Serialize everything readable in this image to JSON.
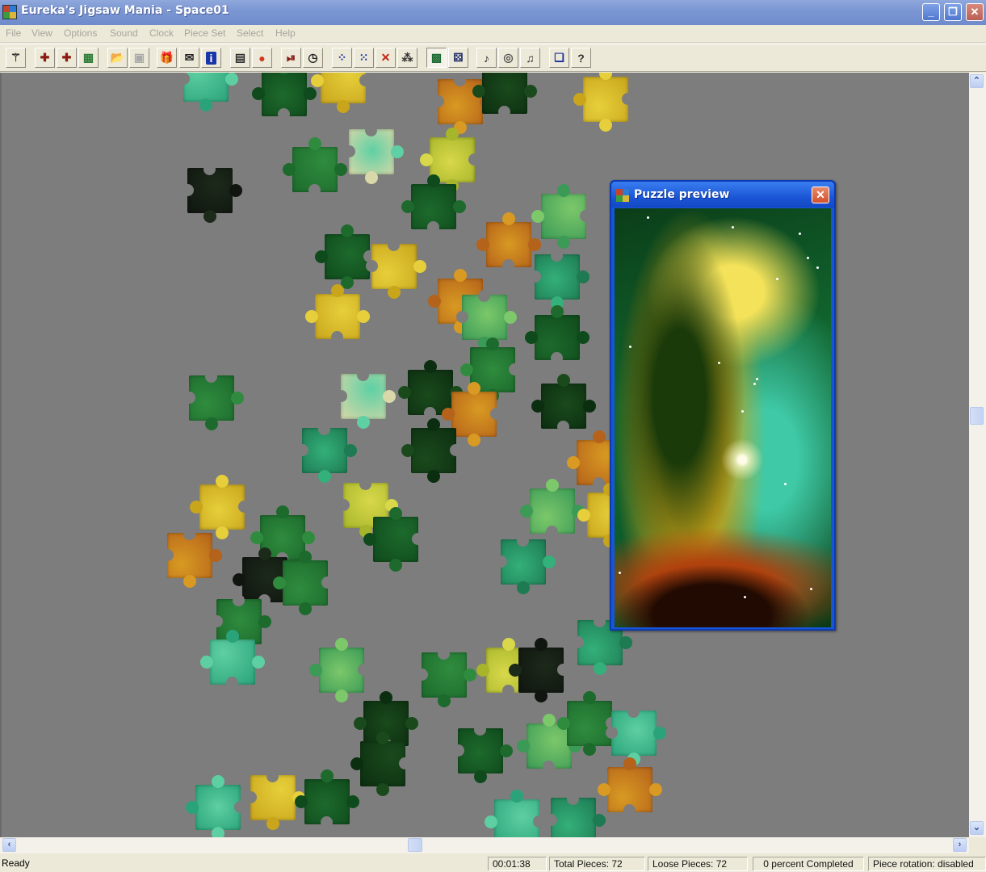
{
  "window": {
    "title": "Eureka's Jigsaw Mania - Space01",
    "controls": {
      "minimize": "_",
      "restore": "❐",
      "close": "✕"
    }
  },
  "menu": [
    "File",
    "View",
    "Options",
    "Sound",
    "Clock",
    "Piece Set",
    "Select",
    "Help"
  ],
  "toolbar": [
    {
      "name": "magic-wand",
      "glyph": "⚚",
      "color": "#333"
    },
    {
      "name": "new-puzzle",
      "glyph": "✚",
      "color": "#8b1a12"
    },
    {
      "name": "shuffle-pieces",
      "glyph": "✚",
      "color": "#8b1a12"
    },
    {
      "name": "view-picture",
      "glyph": "▦",
      "color": "#2f7d3a"
    },
    {
      "name": "open-file",
      "glyph": "📂",
      "color": "#a0882a"
    },
    {
      "name": "save-file",
      "glyph": "▣",
      "color": "#a9a9a9"
    },
    {
      "name": "gift",
      "glyph": "🎁",
      "color": "#b2261a"
    },
    {
      "name": "email",
      "glyph": "✉",
      "color": "#222"
    },
    {
      "name": "info",
      "glyph": "i",
      "color": "#fff"
    },
    {
      "name": "properties",
      "glyph": "▤",
      "color": "#333"
    },
    {
      "name": "colors",
      "glyph": "●",
      "color": "#d2381f"
    },
    {
      "name": "timer-pause",
      "glyph": "⏯",
      "color": "#8b1a12"
    },
    {
      "name": "clock-reset",
      "glyph": "◷",
      "color": "#222"
    },
    {
      "name": "select-all-pieces",
      "glyph": "⁘",
      "color": "#1a2fa0"
    },
    {
      "name": "select-border-pieces",
      "glyph": "⁙",
      "color": "#1a2fa0"
    },
    {
      "name": "delete-selection",
      "glyph": "✕",
      "color": "#c42414"
    },
    {
      "name": "scatter-pieces",
      "glyph": "⁂",
      "color": "#333"
    },
    {
      "name": "show-preview",
      "glyph": "▩",
      "color": "#1d6b33",
      "pressed": true
    },
    {
      "name": "show-box",
      "glyph": "⚄",
      "color": "#1d2a66"
    },
    {
      "name": "music",
      "glyph": "♪",
      "color": "#222"
    },
    {
      "name": "cd-audio",
      "glyph": "◎",
      "color": "#555"
    },
    {
      "name": "playlist",
      "glyph": "♫",
      "color": "#333"
    },
    {
      "name": "arrange-windows",
      "glyph": "❏",
      "color": "#1a2fa0"
    },
    {
      "name": "help",
      "glyph": "?",
      "color": "#333"
    }
  ],
  "preview": {
    "title": "Puzzle preview",
    "close": "✕"
  },
  "scrollbars": {
    "up": "⌃",
    "down": "⌄",
    "left": "‹",
    "right": "›"
  },
  "status": {
    "ready": "Ready",
    "elapsed": "00:01:38",
    "total_pieces": "Total Pieces: 72",
    "loose_pieces": "Loose Pieces: 72",
    "completed": "0 percent Completed",
    "rotation": "Piece rotation: disabled"
  },
  "board": {
    "background": "#7d7d7d",
    "piece_count_visible": 72
  }
}
